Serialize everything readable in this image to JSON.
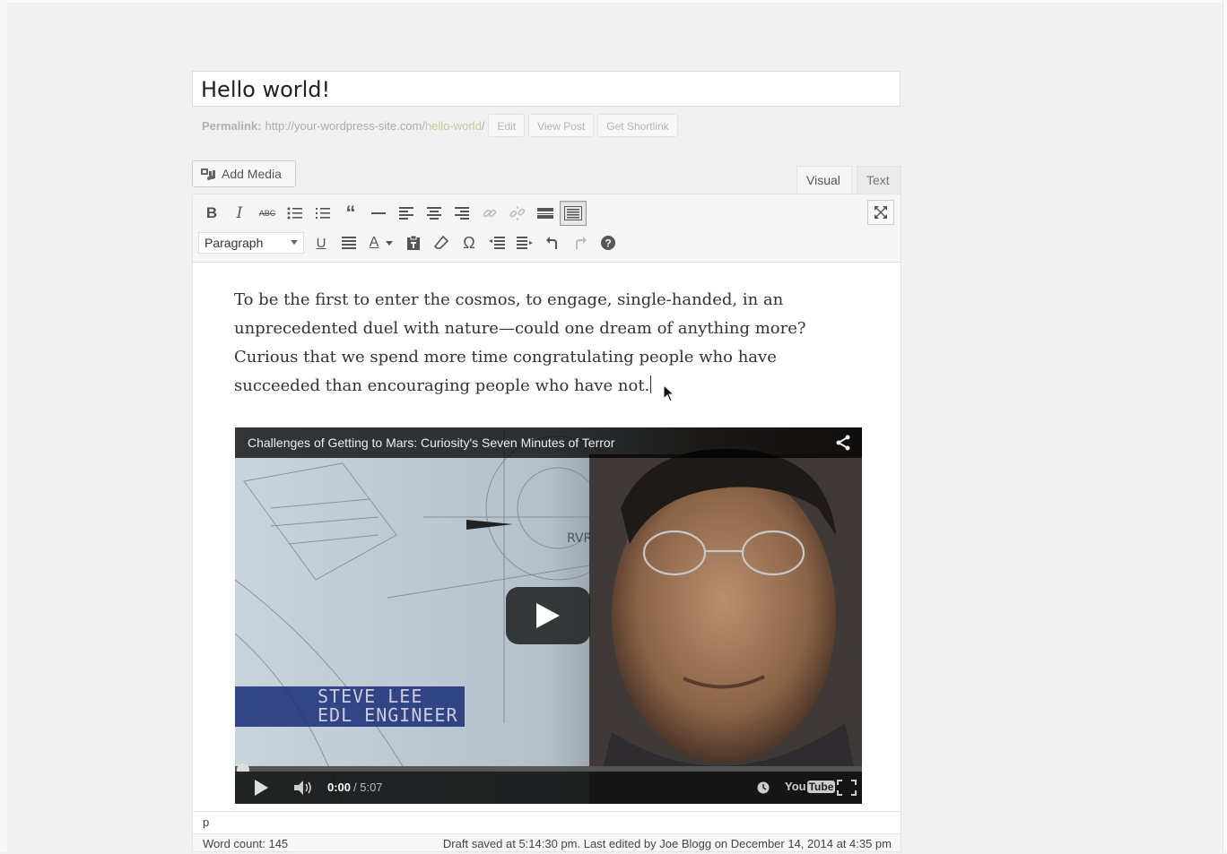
{
  "post": {
    "title": "Hello world!",
    "permalink_label": "Permalink:",
    "permalink_base": "http://your-wordpress-site.com/",
    "permalink_slug": "hello-world",
    "permalink_trail": "/",
    "edit_label": "Edit",
    "view_post_label": "View Post",
    "get_shortlink_label": "Get Shortlink"
  },
  "editor": {
    "add_media_label": "Add Media",
    "tab_visual": "Visual",
    "tab_text": "Text",
    "format_select_value": "Paragraph",
    "toolbar_row1": [
      {
        "name": "bold-button",
        "glyph": "B"
      },
      {
        "name": "italic-button",
        "glyph": "I"
      },
      {
        "name": "strikethrough-button",
        "glyph": "ABC"
      },
      {
        "name": "bullet-list-button",
        "glyph": "☰"
      },
      {
        "name": "numbered-list-button",
        "glyph": "☰"
      },
      {
        "name": "blockquote-button",
        "glyph": "❝"
      },
      {
        "name": "horizontal-rule-button",
        "glyph": "—"
      },
      {
        "name": "align-left-button",
        "glyph": "≡"
      },
      {
        "name": "align-center-button",
        "glyph": "≡"
      },
      {
        "name": "align-right-button",
        "glyph": "≡"
      },
      {
        "name": "insert-link-button",
        "glyph": "🔗"
      },
      {
        "name": "remove-link-button",
        "glyph": "⛓"
      },
      {
        "name": "read-more-button",
        "glyph": "▬"
      },
      {
        "name": "toolbar-toggle-button",
        "glyph": "⌨"
      }
    ],
    "toolbar_row2": [
      {
        "name": "underline-button",
        "glyph": "U"
      },
      {
        "name": "justify-button",
        "glyph": "≣"
      },
      {
        "name": "text-color-button",
        "glyph": "A"
      },
      {
        "name": "paste-as-text-button",
        "glyph": "📋"
      },
      {
        "name": "clear-formatting-button",
        "glyph": "⌫"
      },
      {
        "name": "special-character-button",
        "glyph": "Ω"
      },
      {
        "name": "outdent-button",
        "glyph": "⇤"
      },
      {
        "name": "indent-button",
        "glyph": "⇥"
      },
      {
        "name": "undo-button",
        "glyph": "↶"
      },
      {
        "name": "redo-button",
        "glyph": "↷"
      },
      {
        "name": "help-button",
        "glyph": "?"
      }
    ],
    "body_paragraph": "To be the first to enter the cosmos, to engage, single-handed, in an unprecedented duel with nature—could one dream of anything more? Curious that we spend more time congratulating people who have succeeded than encouraging people who have not.",
    "path_label": "p",
    "word_count": "Word count: 145",
    "draft_status": "Draft saved at 5:14:30 pm. Last edited by Joe Blogg on December 14, 2014 at 4:35 pm"
  },
  "video": {
    "title": "Challenges of Getting to Mars:  Curiosity's Seven Minutes of Terror",
    "caption_name": "STEVE LEE",
    "caption_role": "EDL ENGINEER",
    "time_current": "0:00",
    "time_total": "/ 5:07",
    "youtube_you": "You",
    "youtube_tube": "Tube",
    "progress": 0
  },
  "colors": {
    "background": "#f1f1f1",
    "toolbar": "#f5f5f5",
    "slug_highlight": "#c7c89a"
  }
}
